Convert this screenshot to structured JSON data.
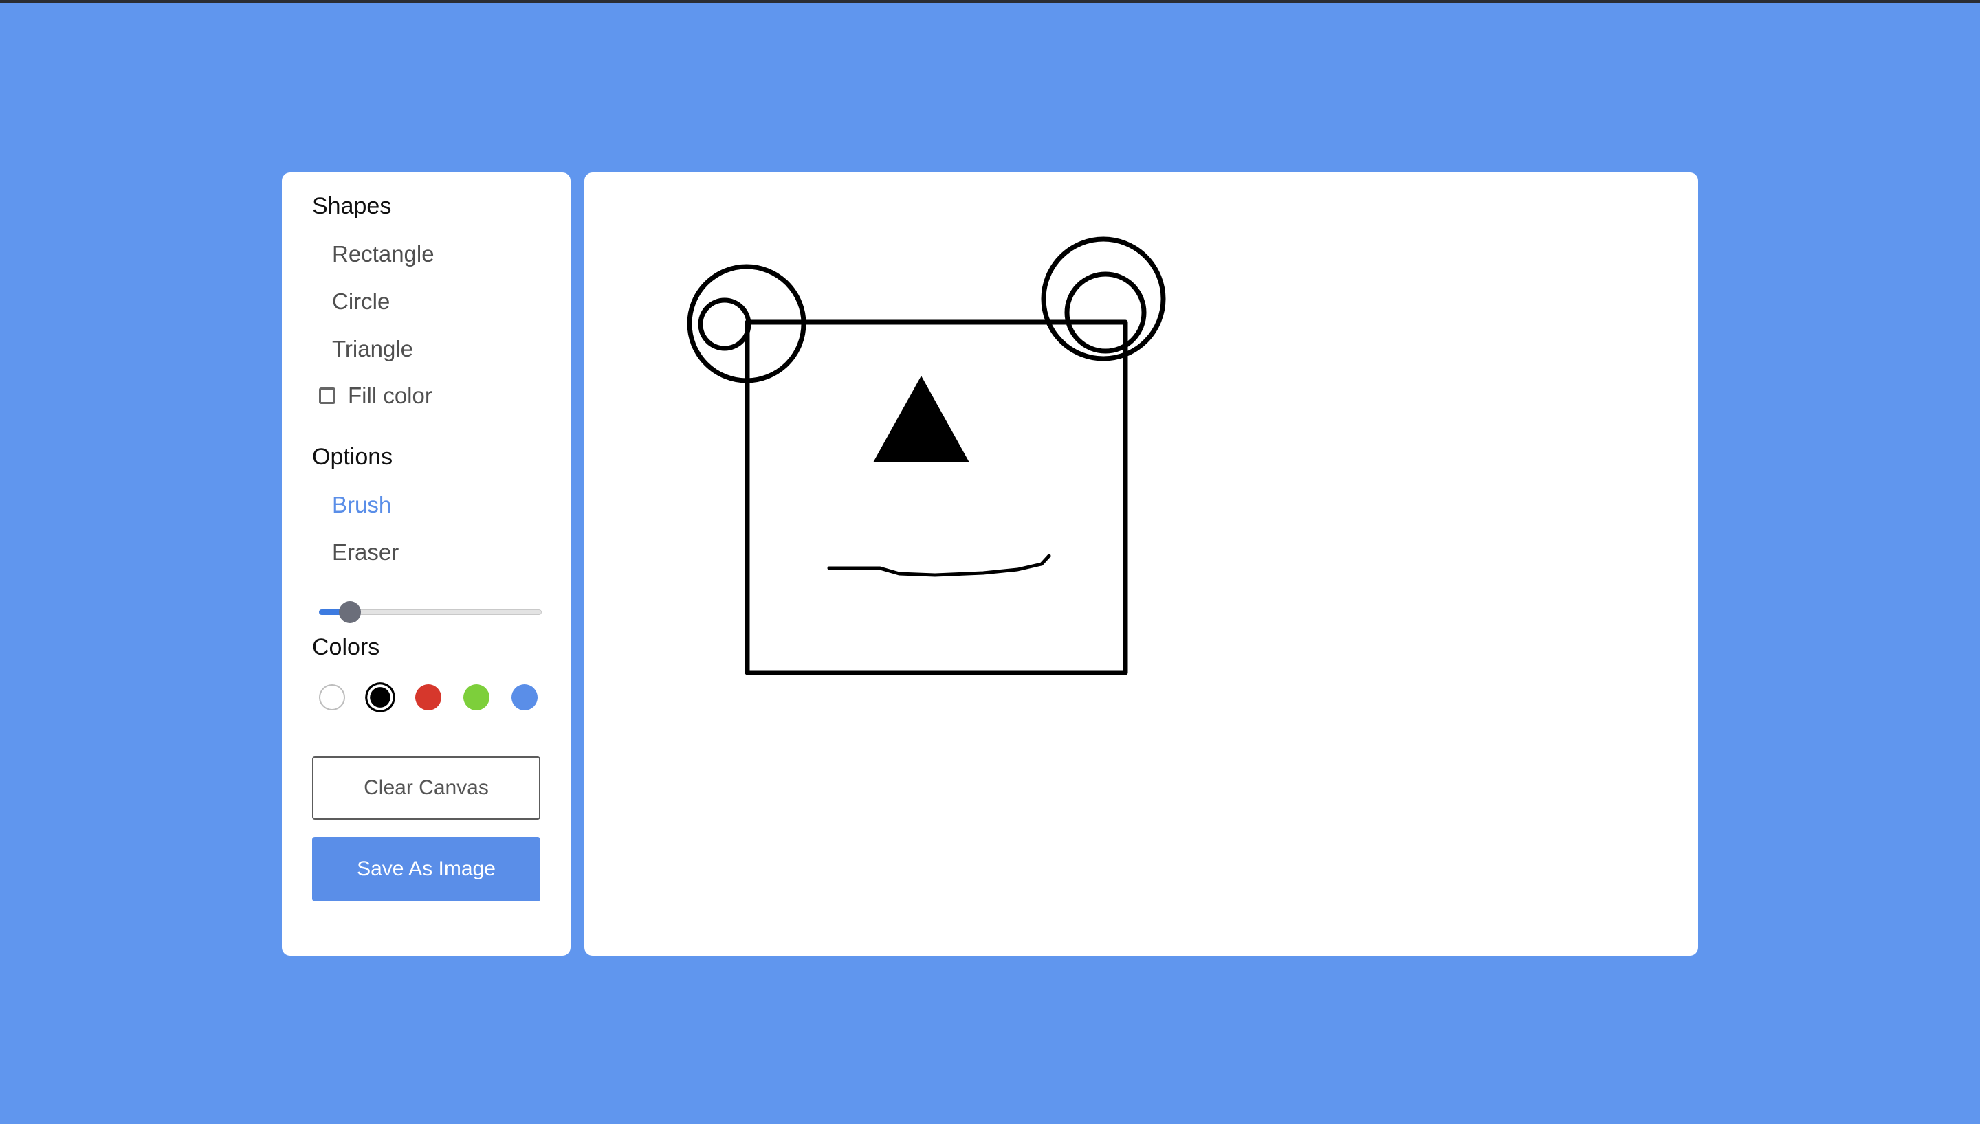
{
  "toolbox": {
    "shapes_title": "Shapes",
    "shapes": [
      {
        "label": "Rectangle"
      },
      {
        "label": "Circle"
      },
      {
        "label": "Triangle"
      }
    ],
    "fill_color_label": "Fill color",
    "fill_color_checked": false,
    "options_title": "Options",
    "options": [
      {
        "label": "Brush",
        "active": true
      },
      {
        "label": "Eraser",
        "active": false
      }
    ],
    "brush_size_fraction": 0.12,
    "colors_title": "Colors",
    "colors": [
      {
        "name": "white",
        "hex": "#ffffff",
        "selected": false
      },
      {
        "name": "black",
        "hex": "#000000",
        "selected": true
      },
      {
        "name": "red",
        "hex": "#d6372c",
        "selected": false
      },
      {
        "name": "green",
        "hex": "#7dcf3b",
        "selected": false
      },
      {
        "name": "blue",
        "hex": "#5a8ee8",
        "selected": false
      }
    ],
    "clear_label": "Clear Canvas",
    "save_label": "Save As Image"
  },
  "theme": {
    "background": "#6096ee",
    "accent": "#5a8ee8"
  }
}
